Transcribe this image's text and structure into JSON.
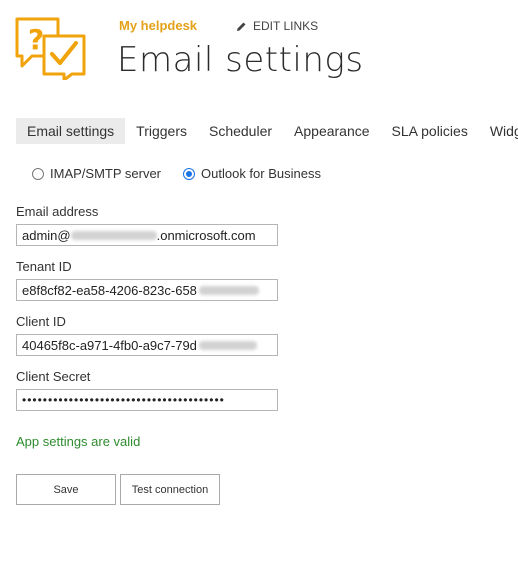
{
  "header": {
    "site_title": "My helpdesk",
    "edit_links_label": "EDIT LINKS",
    "page_title": "Email settings",
    "logo_colors": {
      "primary": "#f0a30a"
    }
  },
  "tabs": [
    {
      "label": "Email settings",
      "active": true
    },
    {
      "label": "Triggers"
    },
    {
      "label": "Scheduler"
    },
    {
      "label": "Appearance"
    },
    {
      "label": "SLA policies"
    },
    {
      "label": "Widg"
    }
  ],
  "server_type": {
    "options": [
      {
        "label": "IMAP/SMTP server",
        "checked": false
      },
      {
        "label": "Outlook for Business",
        "checked": true
      }
    ]
  },
  "form": {
    "email": {
      "label": "Email address",
      "value_prefix": "admin@",
      "value_suffix": ".onmicrosoft.com"
    },
    "tenant": {
      "label": "Tenant ID",
      "value_prefix": "e8f8cf82-ea58-4206-823c-658"
    },
    "client": {
      "label": "Client ID",
      "value_prefix": "40465f8c-a971-4fb0-a9c7-79d"
    },
    "secret": {
      "label": "Client Secret",
      "value": "•••••••••••••••••••••••••••••••••••••••"
    }
  },
  "status": {
    "text": "App settings are valid",
    "color": "#2e8b2e"
  },
  "buttons": {
    "save": "Save",
    "test": "Test connection"
  }
}
